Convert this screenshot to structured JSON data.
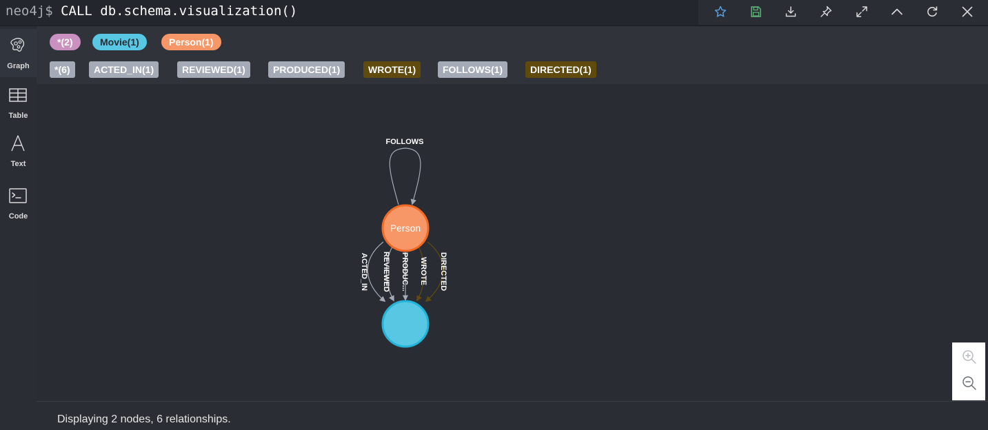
{
  "command": {
    "prompt": "neo4j$",
    "query": "CALL db.schema.visualization()"
  },
  "toolbar": {
    "buttons": [
      {
        "name": "favorite",
        "icon": "star-icon"
      },
      {
        "name": "save",
        "icon": "save-icon"
      },
      {
        "name": "download",
        "icon": "download-icon"
      },
      {
        "name": "pin",
        "icon": "pin-icon"
      },
      {
        "name": "fullscreen",
        "icon": "expand-icon"
      },
      {
        "name": "collapse",
        "icon": "chevron-up-icon"
      },
      {
        "name": "rerun",
        "icon": "refresh-icon"
      },
      {
        "name": "close",
        "icon": "close-icon"
      }
    ]
  },
  "sidebar": {
    "items": [
      {
        "label": "Graph",
        "icon": "graph-icon",
        "active": true
      },
      {
        "label": "Table",
        "icon": "table-icon",
        "active": false
      },
      {
        "label": "Text",
        "icon": "text-icon",
        "active": false
      },
      {
        "label": "Code",
        "icon": "code-icon",
        "active": false
      }
    ]
  },
  "legend": {
    "node_labels": [
      {
        "text": "*(2)",
        "color": "#c990c0",
        "text_color": "#ffffff"
      },
      {
        "text": "Movie(1)",
        "color": "#57c7e3",
        "text_color": "#2a2c34"
      },
      {
        "text": "Person(1)",
        "color": "#f79767",
        "text_color": "#ffffff"
      }
    ],
    "relationship_types": [
      {
        "text": "*(6)",
        "color": "#a5abb6",
        "text_color": "#ffffff"
      },
      {
        "text": "ACTED_IN(1)",
        "color": "#a5abb6",
        "text_color": "#ffffff"
      },
      {
        "text": "REVIEWED(1)",
        "color": "#a5abb6",
        "text_color": "#ffffff"
      },
      {
        "text": "PRODUCED(1)",
        "color": "#a5abb6",
        "text_color": "#ffffff"
      },
      {
        "text": "WROTE(1)",
        "color": "#604a0e",
        "text_color": "#ffffff"
      },
      {
        "text": "FOLLOWS(1)",
        "color": "#a5abb6",
        "text_color": "#ffffff"
      },
      {
        "text": "DIRECTED(1)",
        "color": "#604a0e",
        "text_color": "#ffffff"
      }
    ]
  },
  "graph": {
    "nodes": [
      {
        "id": "person",
        "caption": "Person",
        "color": "#f79767",
        "border": "#f36924"
      },
      {
        "id": "movie",
        "caption": "",
        "color": "#57c7e3",
        "border": "#23b3d7"
      }
    ],
    "relationships": [
      {
        "type": "FOLLOWS",
        "from": "person",
        "to": "person",
        "color": "#a5abb6",
        "label": "FOLLOWS"
      },
      {
        "type": "ACTED_IN",
        "from": "person",
        "to": "movie",
        "color": "#a5abb6",
        "label": "ACTED_IN"
      },
      {
        "type": "REVIEWED",
        "from": "person",
        "to": "movie",
        "color": "#a5abb6",
        "label": "REVIEWED"
      },
      {
        "type": "PRODUCED",
        "from": "person",
        "to": "movie",
        "color": "#a5abb6",
        "label": "PRODUC..."
      },
      {
        "type": "WROTE",
        "from": "person",
        "to": "movie",
        "color": "#604a0e",
        "label": "WROTE"
      },
      {
        "type": "DIRECTED",
        "from": "person",
        "to": "movie",
        "color": "#604a0e",
        "label": "DIRECTED"
      }
    ]
  },
  "zoom": {
    "in_icon": "zoom-in-icon",
    "out_icon": "zoom-out-icon"
  },
  "status": {
    "text": "Displaying 2 nodes, 6 relationships."
  }
}
